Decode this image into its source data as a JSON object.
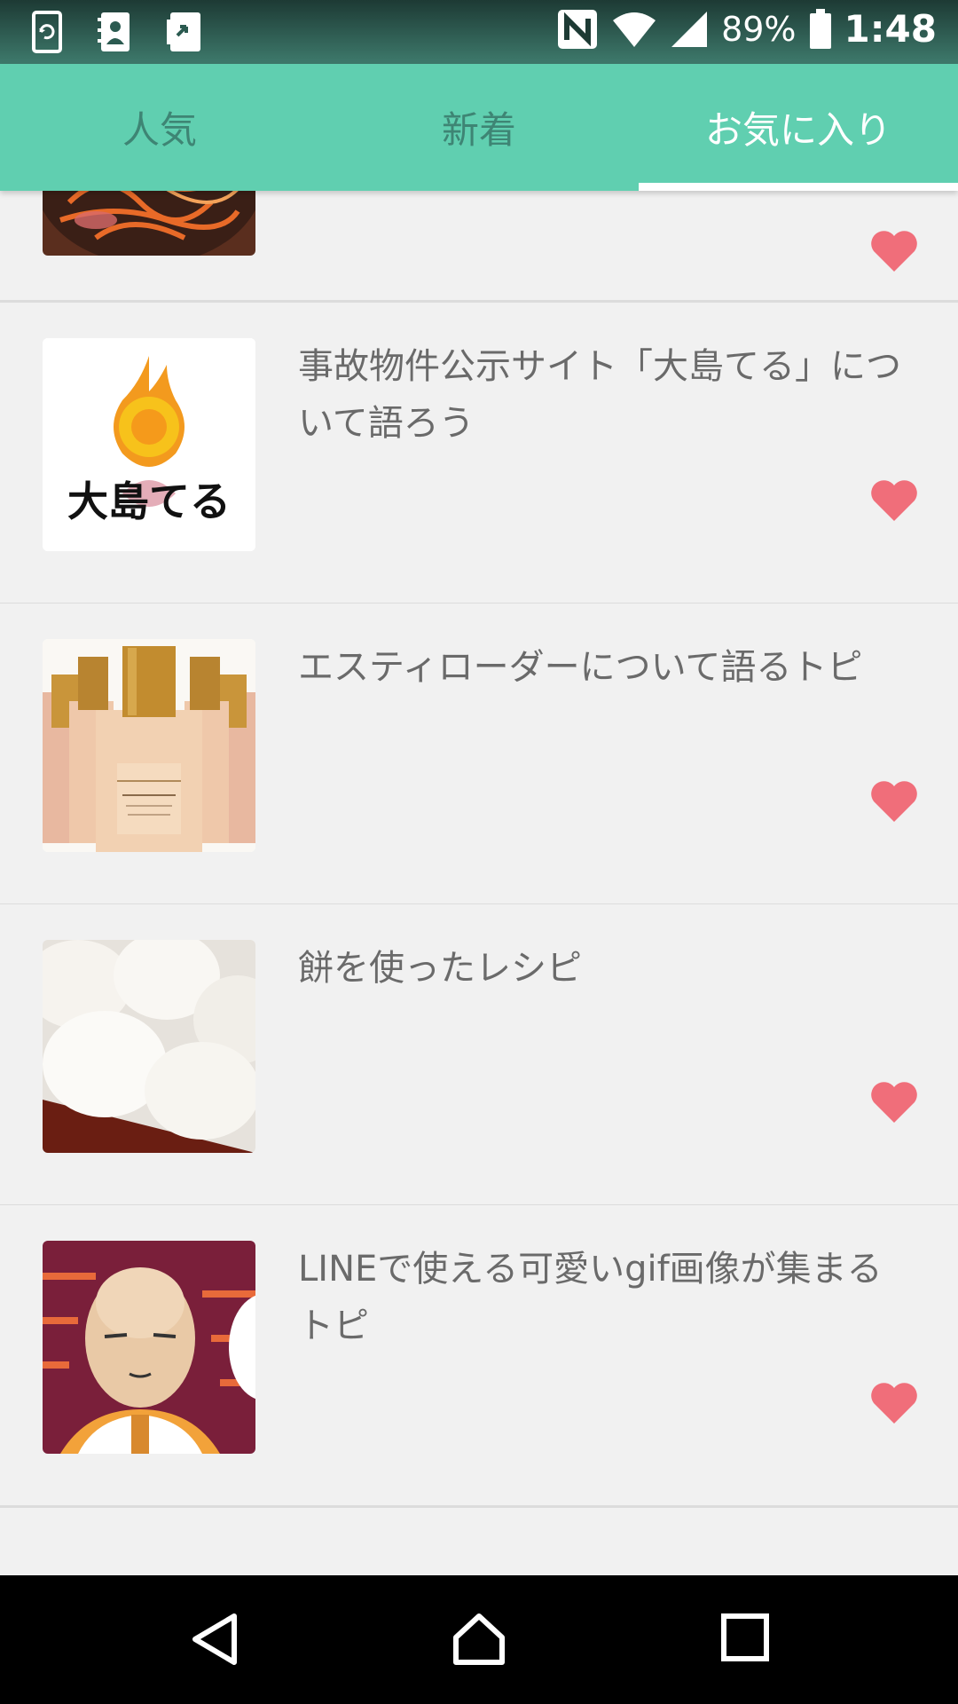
{
  "status_bar": {
    "battery": "89%",
    "time": "1:48",
    "left_icons": [
      "sync-app-icon",
      "contacts-app-icon",
      "share-app-icon"
    ],
    "right_icons": [
      "nfc-icon",
      "wifi-icon",
      "signal-icon",
      "battery-icon"
    ]
  },
  "tabs": [
    {
      "label": "人気",
      "active": false
    },
    {
      "label": "新着",
      "active": false
    },
    {
      "label": "お気に入り",
      "active": true
    }
  ],
  "colors": {
    "header": "#60cfb0",
    "heart": "#f06e7a",
    "tab_inactive": "#3e8574",
    "title_text": "#6a6a6a"
  },
  "topics": [
    {
      "title": "",
      "thumbnail": "napolitan-pasta",
      "favorited": true
    },
    {
      "title": "事故物件公示サイト「大島てる」について語ろう",
      "thumbnail": "oshimateru-logo",
      "favorited": true
    },
    {
      "title": "エスティローダーについて語るトピ",
      "thumbnail": "estee-lauder-bottles",
      "favorited": true
    },
    {
      "title": "餅を使ったレシピ",
      "thumbnail": "mochi",
      "favorited": true
    },
    {
      "title": "LINEで使える可愛いgif画像が集まるトピ",
      "thumbnail": "anime-character",
      "favorited": true
    }
  ],
  "nav": {
    "icons": [
      "back-icon",
      "home-icon",
      "recents-icon"
    ]
  }
}
